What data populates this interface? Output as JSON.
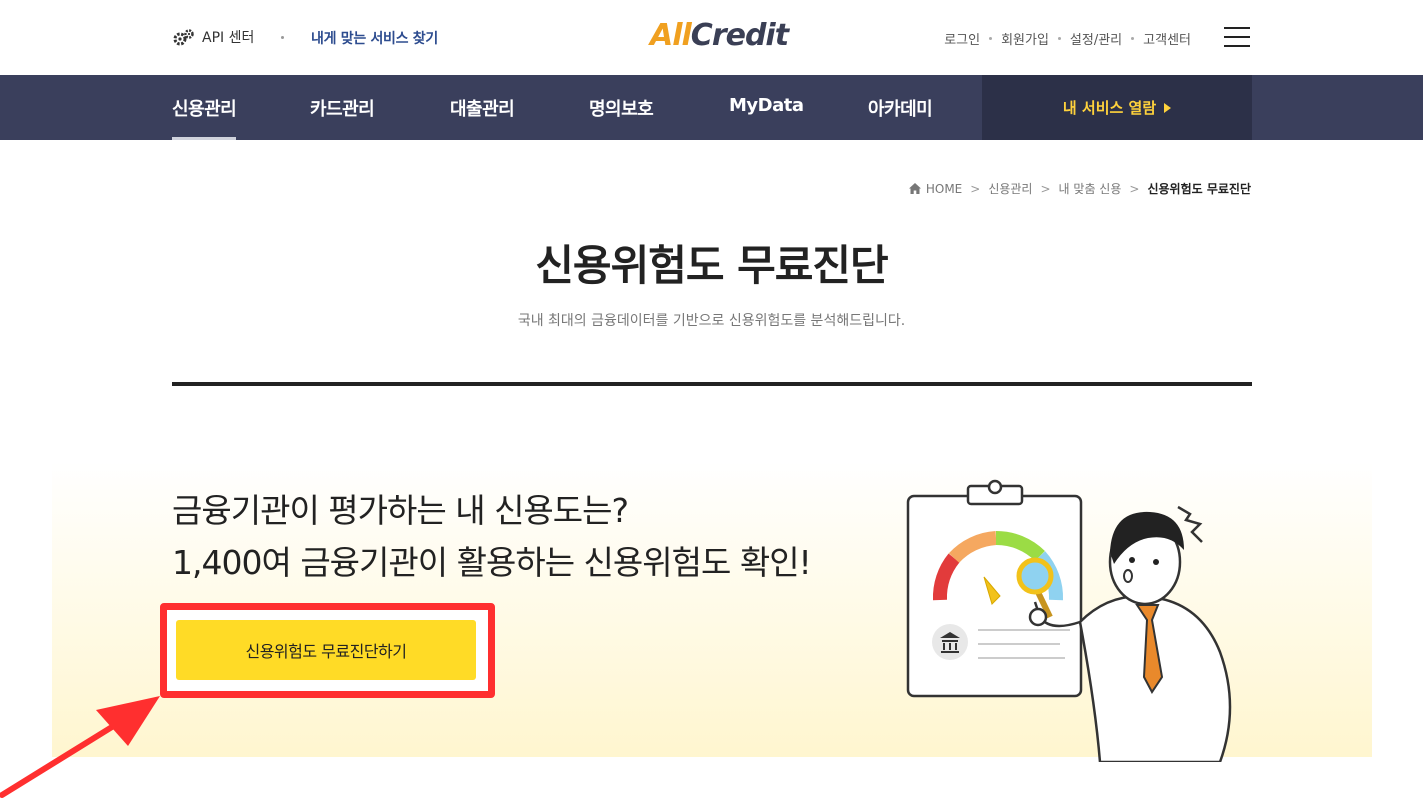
{
  "header": {
    "api_label": "API 센터",
    "find_service": "내게 맞는 서비스 찾기",
    "logo_all": "All",
    "logo_credit": "Credit",
    "util_links": [
      "로그인",
      "회원가입",
      "설정/관리",
      "고객센터"
    ]
  },
  "nav": {
    "items": [
      "신용관리",
      "카드관리",
      "대출관리",
      "명의보호",
      "MyData",
      "아카데미"
    ],
    "active_index": 0,
    "my_service": "내 서비스 열람"
  },
  "breadcrumb": {
    "items": [
      "HOME",
      "신용관리",
      "내 맞춤 신용",
      "신용위험도 무료진단"
    ]
  },
  "page": {
    "title": "신용위험도 무료진단",
    "subtitle": "국내 최대의 금융데이터를 기반으로 신용위험도를 분석해드립니다."
  },
  "hero": {
    "line1": "금융기관이 평가하는 내 신용도는?",
    "line2": "1,400여 금융기관이 활용하는 신용위험도 확인!",
    "cta_label": "신용위험도 무료진단하기"
  },
  "colors": {
    "nav_bg": "#3a3f5c",
    "accent_yellow": "#ffdb26",
    "highlight_red": "#ff2f2f"
  }
}
